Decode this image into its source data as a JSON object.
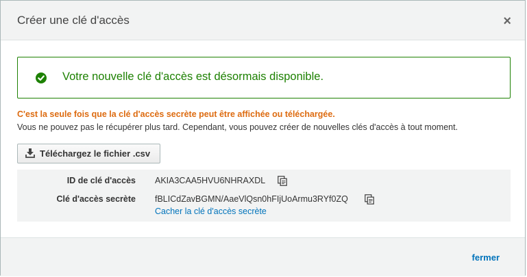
{
  "dialog": {
    "title": "Créer une clé d'accès",
    "close_icon": "close-icon"
  },
  "success": {
    "icon": "check-circle-icon",
    "message": "Votre nouvelle clé d'accès est désormais disponible.",
    "color": "#1d8102"
  },
  "warning": {
    "text": "C'est la seule fois que la clé d'accès secrète peut être affichée ou téléchargée.",
    "color": "#dd6b10"
  },
  "info": {
    "text": "Vous ne pouvez pas le récupérer plus tard. Cependant, vous pouvez créer de nouvelles clés d'accès à tout moment."
  },
  "download": {
    "icon": "download-icon",
    "label": "Téléchargez le fichier .csv"
  },
  "keys": {
    "access_key_id_label": "ID de clé d'accès",
    "access_key_id_value": "AKIA3CAA5HVU6NHRAXDL",
    "secret_key_label": "Clé d'accès secrète",
    "secret_key_value": "fBLICdZavBGMN/AaeVlQsn0hFIjUoArmu3RYf0ZQ",
    "hide_secret_link": "Cacher la clé d'accès secrète",
    "copy_icon": "copy-icon"
  },
  "footer": {
    "close_label": "fermer"
  },
  "colors": {
    "link": "#0073bb",
    "panel_bg": "#f2f3f3"
  }
}
